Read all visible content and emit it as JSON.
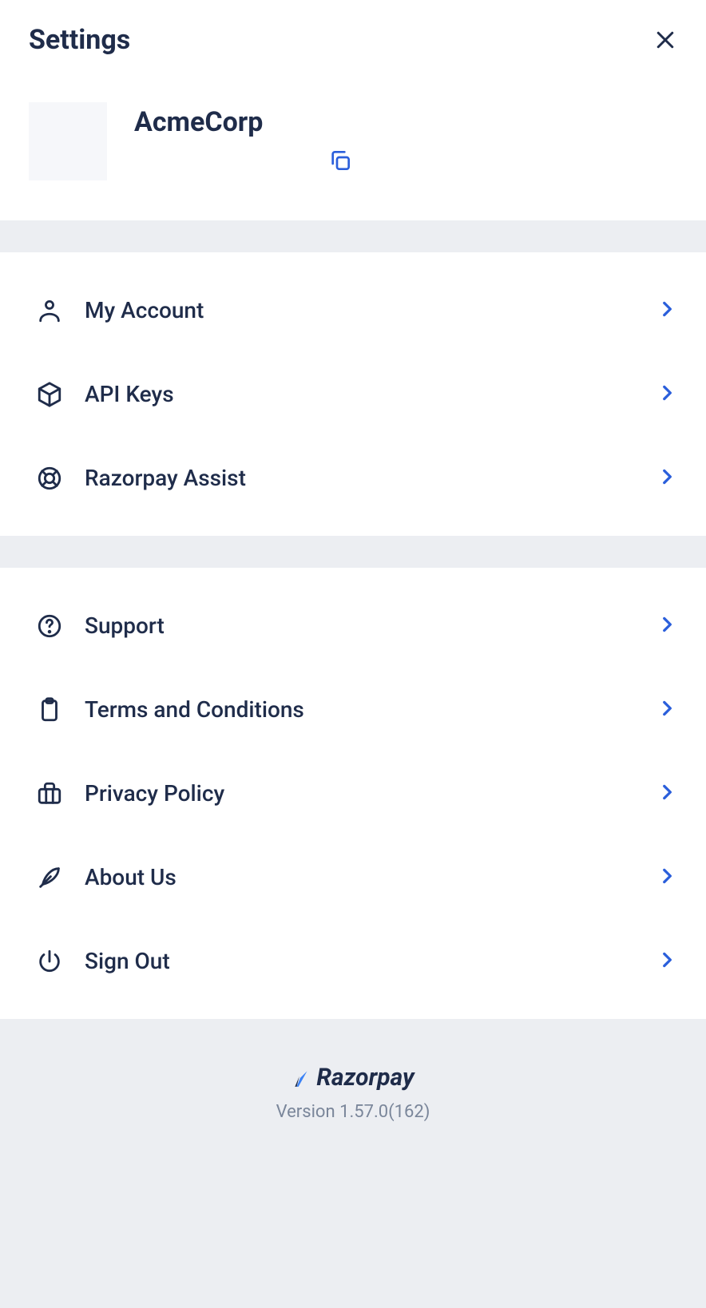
{
  "header": {
    "title": "Settings"
  },
  "profile": {
    "name": "AcmeCorp"
  },
  "section1": [
    {
      "icon": "user-icon",
      "label": "My Account"
    },
    {
      "icon": "cube-icon",
      "label": "API Keys"
    },
    {
      "icon": "lifebuoy-icon",
      "label": "Razorpay Assist"
    }
  ],
  "section2": [
    {
      "icon": "question-icon",
      "label": "Support"
    },
    {
      "icon": "clipboard-icon",
      "label": "Terms and Conditions"
    },
    {
      "icon": "briefcase-icon",
      "label": "Privacy Policy"
    },
    {
      "icon": "feather-icon",
      "label": "About Us"
    },
    {
      "icon": "power-icon",
      "label": "Sign Out"
    }
  ],
  "footer": {
    "brand": "Razorpay",
    "version": "Version 1.57.0(162)"
  }
}
